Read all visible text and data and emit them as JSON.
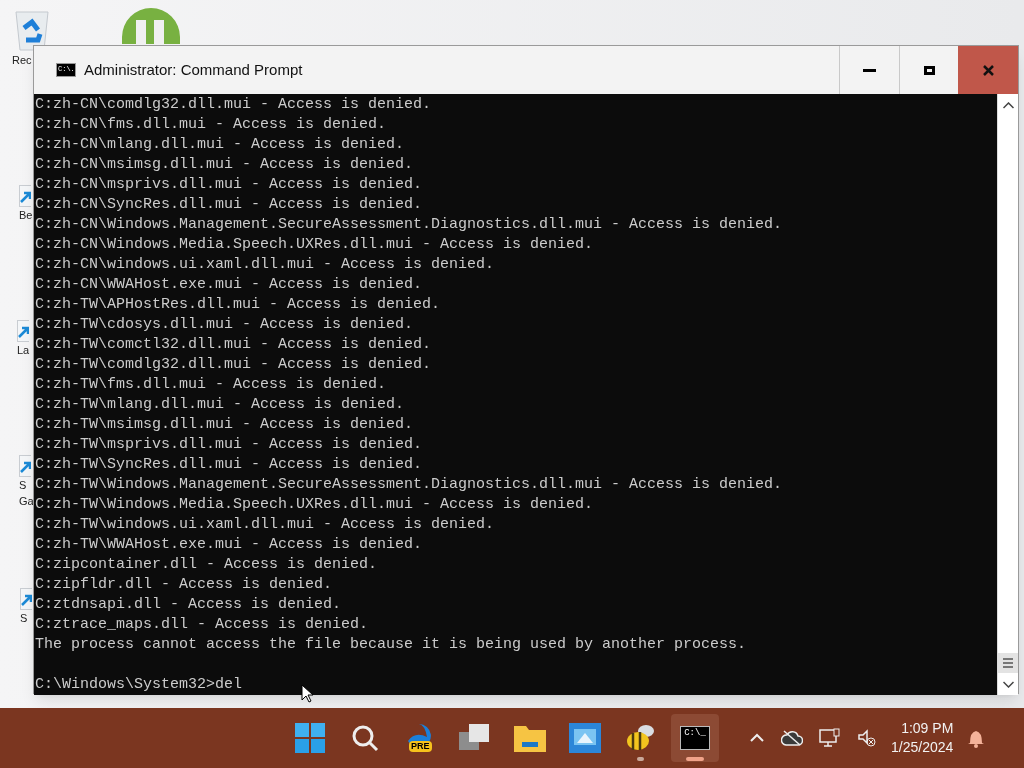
{
  "desktop_icons": [
    {
      "kind": "recycle",
      "label": [
        "Rec"
      ]
    },
    {
      "kind": "torrent"
    },
    {
      "kind": "shortcut",
      "label": [
        "Be"
      ]
    },
    {
      "kind": "shortcut",
      "label": [
        "La"
      ]
    },
    {
      "kind": "shortcut",
      "label": [
        "S",
        "Ga"
      ]
    },
    {
      "kind": "shortcut",
      "label": [
        "S"
      ]
    }
  ],
  "window": {
    "title": "Administrator: Command Prompt",
    "title_icon": "C:\\."
  },
  "console": {
    "lines": [
      "C:zh-CN\\comdlg32.dll.mui - Access is denied.",
      "C:zh-CN\\fms.dll.mui - Access is denied.",
      "C:zh-CN\\mlang.dll.mui - Access is denied.",
      "C:zh-CN\\msimsg.dll.mui - Access is denied.",
      "C:zh-CN\\msprivs.dll.mui - Access is denied.",
      "C:zh-CN\\SyncRes.dll.mui - Access is denied.",
      "C:zh-CN\\Windows.Management.SecureAssessment.Diagnostics.dll.mui - Access is denied.",
      "C:zh-CN\\Windows.Media.Speech.UXRes.dll.mui - Access is denied.",
      "C:zh-CN\\windows.ui.xaml.dll.mui - Access is denied.",
      "C:zh-CN\\WWAHost.exe.mui - Access is denied.",
      "C:zh-TW\\APHostRes.dll.mui - Access is denied.",
      "C:zh-TW\\cdosys.dll.mui - Access is denied.",
      "C:zh-TW\\comctl32.dll.mui - Access is denied.",
      "C:zh-TW\\comdlg32.dll.mui - Access is denied.",
      "C:zh-TW\\fms.dll.mui - Access is denied.",
      "C:zh-TW\\mlang.dll.mui - Access is denied.",
      "C:zh-TW\\msimsg.dll.mui - Access is denied.",
      "C:zh-TW\\msprivs.dll.mui - Access is denied.",
      "C:zh-TW\\SyncRes.dll.mui - Access is denied.",
      "C:zh-TW\\Windows.Management.SecureAssessment.Diagnostics.dll.mui - Access is denied.",
      "C:zh-TW\\Windows.Media.Speech.UXRes.dll.mui - Access is denied.",
      "C:zh-TW\\windows.ui.xaml.dll.mui - Access is denied.",
      "C:zh-TW\\WWAHost.exe.mui - Access is denied.",
      "C:zipcontainer.dll - Access is denied.",
      "C:zipfldr.dll - Access is denied.",
      "C:ztdnsapi.dll - Access is denied.",
      "C:ztrace_maps.dll - Access is denied.",
      "The process cannot access the file because it is being used by another process."
    ],
    "prompt": "C:\\Windows\\System32>del"
  },
  "taskbar": {
    "apps": [
      {
        "kind": "start",
        "selected": false,
        "running": false
      },
      {
        "kind": "search",
        "selected": false,
        "running": false
      },
      {
        "kind": "edge",
        "badge": "PRE",
        "selected": false,
        "running": false
      },
      {
        "kind": "taskview",
        "selected": false,
        "running": false
      },
      {
        "kind": "folder",
        "selected": false,
        "running": false
      },
      {
        "kind": "remote",
        "selected": false,
        "running": false
      },
      {
        "kind": "bee",
        "selected": false,
        "running": true
      },
      {
        "kind": "terminal",
        "glyph": "C:\\_",
        "selected": true,
        "running": true
      }
    ],
    "time": "1:09 PM",
    "date": "1/25/2024"
  }
}
